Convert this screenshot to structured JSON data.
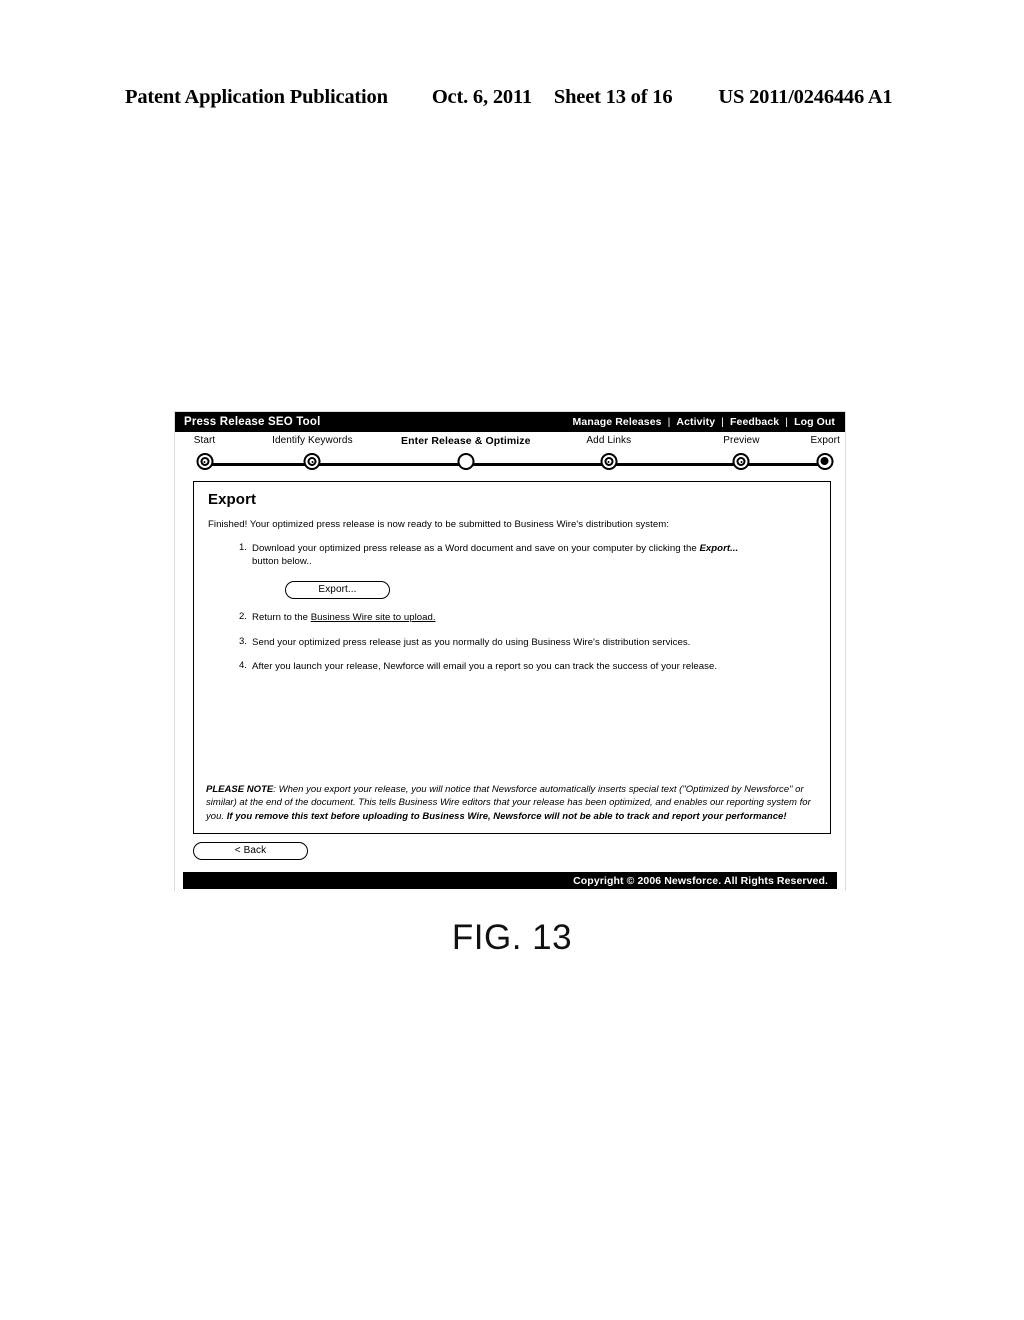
{
  "patent_header": {
    "publication": "Patent Application Publication",
    "date": "Oct. 6, 2011",
    "sheet": "Sheet 13 of 16",
    "number": "US 2011/0246446 A1"
  },
  "figure_caption": "FIG. 13",
  "app": {
    "title": "Press Release SEO Tool",
    "nav": [
      {
        "label": "Manage Releases"
      },
      {
        "label": "Activity"
      },
      {
        "label": "Feedback"
      },
      {
        "label": "Log Out"
      }
    ],
    "nav_separator": "|",
    "steps": [
      {
        "label": "Start",
        "state": "done",
        "bold": false,
        "x": 3
      },
      {
        "label": "Identify Keywords",
        "state": "done",
        "bold": false,
        "x": 19.6
      },
      {
        "label": "Enter Release & Optimize",
        "state": "open",
        "bold": true,
        "x": 43.2
      },
      {
        "label": "Add Links",
        "state": "done",
        "bold": false,
        "x": 65.2
      },
      {
        "label": "Preview",
        "state": "done",
        "bold": false,
        "x": 85.6
      },
      {
        "label": "Export",
        "state": "current",
        "bold": false,
        "x": 98.5
      }
    ],
    "panel": {
      "title": "Export",
      "intro": "Finished! Your optimized press release is now ready to be submitted to Business Wire's distribution system:",
      "items": [
        {
          "num": "1.",
          "text_before": "Download your optimized press release as a Word document and save on your computer by clicking the ",
          "emphasis": "Export...",
          "text_after": " button below.."
        },
        {
          "num": "2.",
          "text_before": "Return to the ",
          "link": "Business Wire site to upload.",
          "text_after": ""
        },
        {
          "num": "3.",
          "text_before": "Send your optimized press release just as you normally do using Business Wire's distribution services.",
          "text_after": ""
        },
        {
          "num": "4.",
          "text_before": "After you launch your release, Newforce will email you a report so you can track the success of your release.",
          "text_after": ""
        }
      ],
      "export_button": "Export...",
      "note": {
        "lead": "PLEASE NOTE",
        "body_1": ": When you export your release, you will notice that Newsforce automatically inserts special text (\"Optimized by Newsforce\" or similar) at the end of the document. This tells Business Wire editors that your release has been optimized, and enables our reporting system for you. ",
        "body_bold": "If you remove this text before uploading to Business Wire, Newsforce will not be able to track and report your performance!"
      }
    },
    "back_button": "< Back",
    "footer": "Copyright © 2006 Newsforce. All Rights Reserved."
  },
  "colors": {
    "bar_background": "#000000",
    "bar_text": "#ffffff",
    "panel_border": "#000000",
    "page_background": "#ffffff"
  }
}
